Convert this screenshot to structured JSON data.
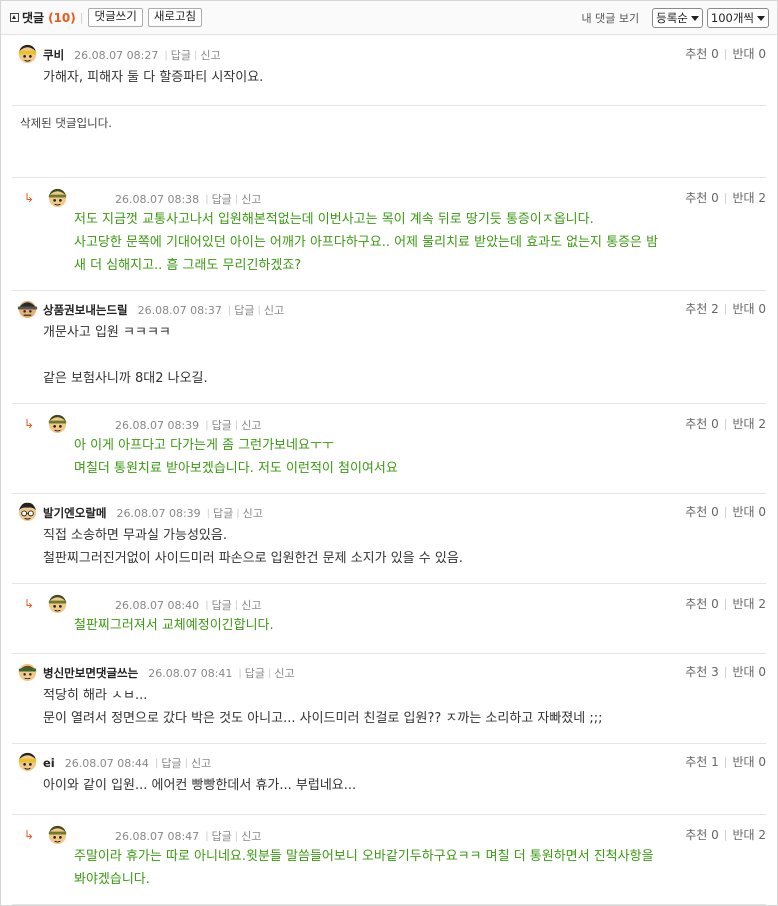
{
  "toolbar": {
    "title": "댓글",
    "count": "(10)",
    "write_label": "댓글쓰기",
    "refresh_label": "새로고침",
    "my_comments_label": "내 댓글 보기",
    "sort_value": "등록순",
    "per_page_value": "100개씩"
  },
  "labels": {
    "reply": "답글",
    "report": "신고",
    "up": "추천",
    "down": "반대"
  },
  "comments": [
    {
      "type": "comment",
      "nick": "쿠비",
      "date": "26.08.07 08:27",
      "up": "0",
      "down": "0",
      "lines": [
        "가해자, 피해자 둘 다 할증파티 시작이요."
      ]
    },
    {
      "type": "deleted",
      "text": "삭제된 댓글입니다."
    },
    {
      "type": "reply",
      "nick": "",
      "date": "26.08.07 08:38",
      "up": "0",
      "down": "2",
      "lines": [
        "저도 지금껏 교통사고나서 입원해본적없는데 이번사고는 목이 계속 뒤로 땅기듯 통증이ㅈ옵니다.",
        "사고당한 문쪽에 기대어있던 아이는 어깨가 아프다하구요.. 어제 물리치료 받았는데 효과도 없는지 통증은 밤",
        "새 더 심해지고.. 흠 그래도 무리긴하겠죠?"
      ]
    },
    {
      "type": "comment",
      "nick": "상품권보내는드릴",
      "date": "26.08.07 08:37",
      "up": "2",
      "down": "0",
      "lines": [
        "개문사고 입원 ㅋㅋㅋㅋ",
        "",
        "같은 보험사니까 8대2 나오길."
      ]
    },
    {
      "type": "reply",
      "nick": "",
      "date": "26.08.07 08:39",
      "up": "0",
      "down": "2",
      "lines": [
        "아 이게 아프다고 다가는게 좀 그런가보네요ㅜㅜ",
        "며칠더 통원치료 받아보겠습니다. 저도 이런적이 첨이여서요"
      ]
    },
    {
      "type": "comment",
      "nick": "발기엔오랄메",
      "date": "26.08.07 08:39",
      "up": "0",
      "down": "0",
      "lines": [
        "직접 소송하면 무과실 가능성있음.",
        "철판찌그러진거없이 사이드미러 파손으로 입원한건 문제 소지가 있을 수 있음."
      ]
    },
    {
      "type": "reply",
      "nick": "",
      "date": "26.08.07 08:40",
      "up": "0",
      "down": "2",
      "lines": [
        "철판찌그러져서 교체예정이긴합니다."
      ]
    },
    {
      "type": "comment",
      "nick": "병신만보면댓글쓰는",
      "date": "26.08.07 08:41",
      "up": "3",
      "down": "0",
      "lines": [
        "적당히 해라 ㅅㅂ...",
        "문이 열려서 정면으로 갔다 박은 것도 아니고... 사이드미러 친걸로 입원?? ㅈ까는 소리하고 자빠졌네 ;;;"
      ]
    },
    {
      "type": "comment",
      "nick": "ei",
      "date": "26.08.07 08:44",
      "up": "1",
      "down": "0",
      "lines": [
        "아이와 같이 입원... 에어컨 빵빵한데서 휴가... 부럽네요..."
      ]
    },
    {
      "type": "reply",
      "nick": "",
      "date": "26.08.07 08:47",
      "up": "0",
      "down": "2",
      "lines": [
        "주말이라 휴가는 따로 아니네요.윗분들 말씀들어보니 오바같기두하구요ㅋㅋ 며칠 더 통원하면서 진척사항을",
        "봐야겠습니다."
      ]
    }
  ],
  "colors": {
    "accent": "#e85a1e",
    "reply_text": "#3a9b10",
    "border": "#e5e5e5"
  }
}
